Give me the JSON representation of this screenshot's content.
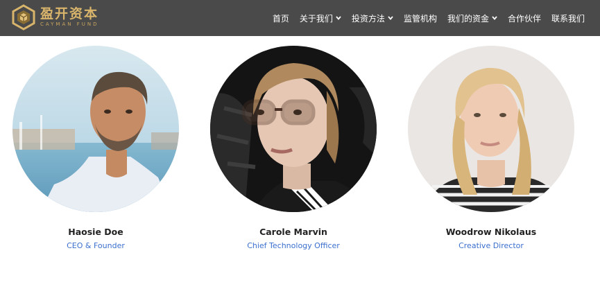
{
  "brand": {
    "name_cn": "盈开资本",
    "name_en": "CAYMAN FUND",
    "accent_color": "#d9b56c"
  },
  "nav": {
    "items": [
      {
        "label": "首页",
        "has_dropdown": false
      },
      {
        "label": "关于我们",
        "has_dropdown": true
      },
      {
        "label": "投资方法",
        "has_dropdown": true
      },
      {
        "label": "监管机构",
        "has_dropdown": false
      },
      {
        "label": "我们的资金",
        "has_dropdown": true
      },
      {
        "label": "合作伙伴",
        "has_dropdown": false
      },
      {
        "label": "联系我们",
        "has_dropdown": false
      }
    ]
  },
  "team": {
    "members": [
      {
        "name": "Haosie Doe",
        "role": "CEO & Founder",
        "photo": "man-portrait-photo"
      },
      {
        "name": "Carole Marvin",
        "role": "Chief Technology Officer",
        "photo": "woman-glasses-portrait-photo"
      },
      {
        "name": "Woodrow Nikolaus",
        "role": "Creative Director",
        "photo": "woman-blonde-portrait-photo"
      }
    ]
  },
  "colors": {
    "navbar_bg": "#4a4a4a",
    "role_text": "#3b6fcf"
  }
}
